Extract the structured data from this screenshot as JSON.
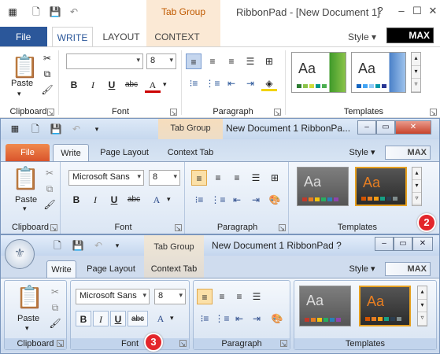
{
  "win1": {
    "tab_group": "Tab Group",
    "title": "RibbonPad - [New Document 1]",
    "style_label": "Style",
    "max_label": "MAX",
    "file_tab": "File",
    "tabs": [
      "WRITE",
      "LAYOUT",
      "CONTEXT"
    ],
    "font_name": "",
    "font_size": "8",
    "groups": {
      "clipboard": "Clipboard",
      "font": "Font",
      "paragraph": "Paragraph",
      "templates": "Templates"
    },
    "paste_label": "Paste",
    "template_thumbs": [
      "Aa",
      "Aa"
    ]
  },
  "win2": {
    "tab_group": "Tab Group",
    "title": "New Document 1 RibbonPa...",
    "style_label": "Style",
    "max_label": "MAX",
    "file_tab": "File",
    "tabs": [
      "Write",
      "Page Layout",
      "Context Tab"
    ],
    "font_name": "Microsoft Sans",
    "font_size": "8",
    "groups": {
      "clipboard": "Clipboard",
      "font": "Font",
      "paragraph": "Paragraph",
      "templates": "Templates"
    },
    "paste_label": "Paste",
    "template_thumbs": [
      "Aa",
      "Aa"
    ],
    "badge": "2"
  },
  "win3": {
    "tab_group": "Tab Group",
    "title": "New Document 1 RibbonPad ?",
    "style_label": "Style",
    "max_label": "MAX",
    "tabs": [
      "Write",
      "Page Layout",
      "Context Tab"
    ],
    "font_name": "Microsoft Sans",
    "font_size": "8",
    "groups": {
      "clipboard": "Clipboard",
      "font": "Font",
      "paragraph": "Paragraph",
      "templates": "Templates"
    },
    "paste_label": "Paste",
    "template_thumbs": [
      "Aa",
      "Aa"
    ],
    "badge": "3"
  },
  "font_buttons": {
    "bold": "B",
    "italic": "I",
    "underline": "U",
    "strike": "abc",
    "color": "A"
  },
  "colors": {
    "office2013_accent": "#2b579a",
    "file_tab_2010": "#d9542b",
    "tab_group_orange": "#c05a00",
    "badge_red": "#e3262b",
    "swatches": [
      "#c0392b",
      "#e67e22",
      "#f1c40f",
      "#27ae60",
      "#2980b9",
      "#8e44ad",
      "#7f8c8d",
      "#d35400"
    ]
  }
}
